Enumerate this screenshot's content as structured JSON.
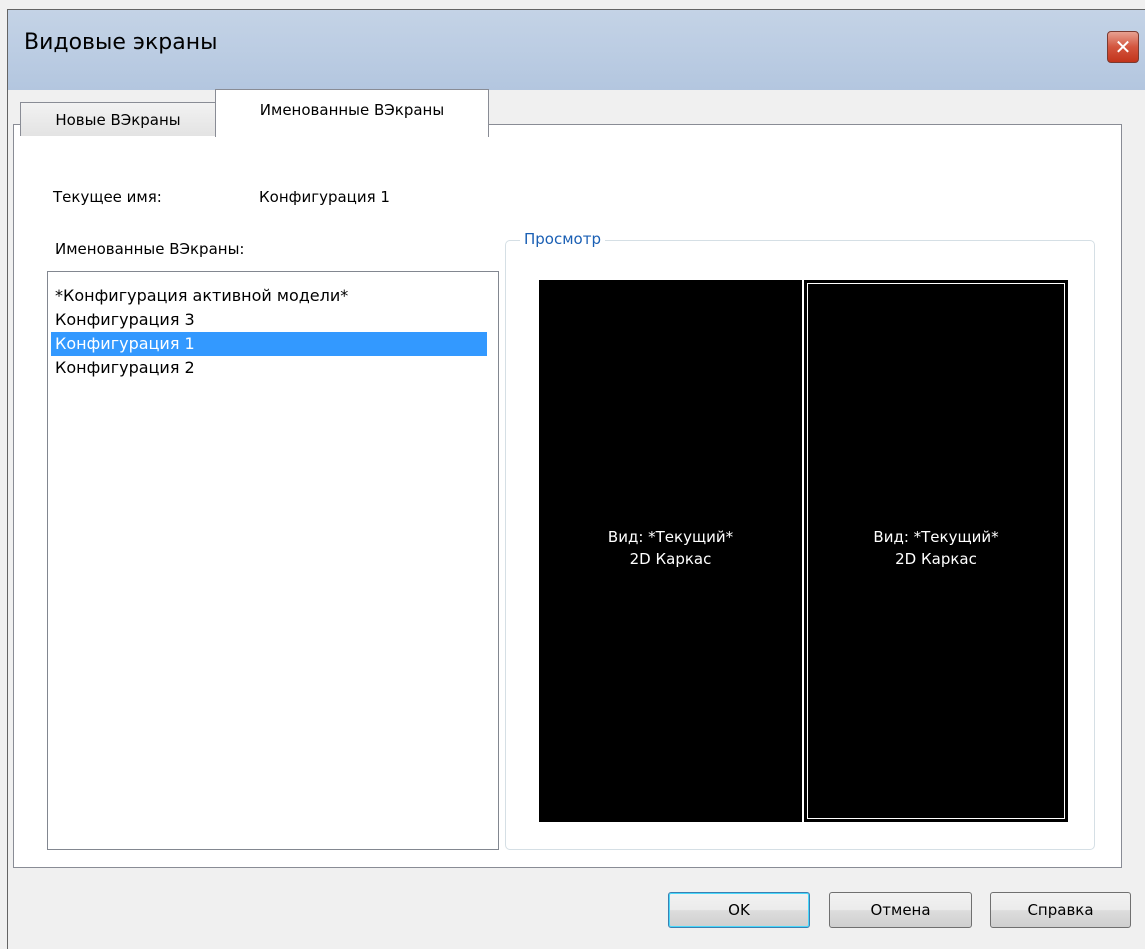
{
  "window": {
    "title": "Видовые экраны"
  },
  "tabs": [
    {
      "label": "Новые ВЭкраны",
      "selected": false
    },
    {
      "label": "Именованные ВЭкраны",
      "selected": true
    }
  ],
  "current_name": {
    "label": "Текущее имя:",
    "value": "Конфигурация 1"
  },
  "named_list": {
    "label": "Именованные ВЭкраны:",
    "items": [
      "*Конфигурация активной модели*",
      "Конфигурация 3",
      "Конфигурация 1",
      "Конфигурация 2"
    ],
    "selected_index": 2
  },
  "preview": {
    "legend": "Просмотр",
    "viewports": [
      {
        "view": "Вид: *Текущий*",
        "style": "2D Каркас",
        "active": false
      },
      {
        "view": "Вид: *Текущий*",
        "style": "2D Каркас",
        "active": true
      }
    ]
  },
  "buttons": {
    "ok": "OK",
    "cancel": "Отмена",
    "help": "Справка"
  },
  "colors": {
    "selection": "#3399ff",
    "legend_text": "#1a5fb4",
    "viewport_bg": "#000000"
  },
  "icons": {
    "close": "close-x-icon"
  }
}
